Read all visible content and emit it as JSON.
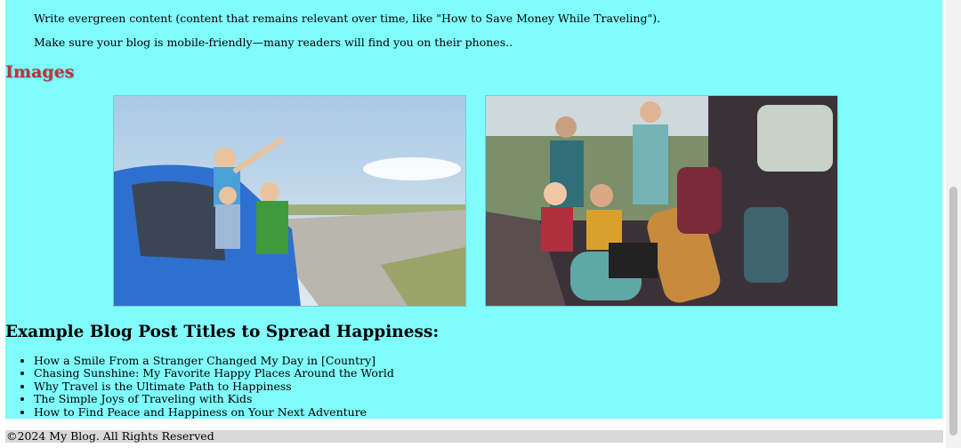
{
  "content": {
    "paragraphs": [
      "Write evergreen content (content that remains relevant over time, like \"How to Save Money While Traveling\").",
      "Make sure your blog is mobile-friendly—many readers will find you on their phones.."
    ],
    "images_heading": "Images",
    "images": [
      {
        "subject": "children waving from a blue car window on a countryside road"
      },
      {
        "subject": "family unpacking luggage from the trunk of a car"
      }
    ],
    "titles_heading": "Example Blog Post Titles to Spread Happiness:",
    "post_titles": [
      "How a Smile From a Stranger Changed My Day in [Country]",
      "Chasing Sunshine: My Favorite Happy Places Around the World",
      "Why Travel is the Ultimate Path to Happiness",
      "The Simple Joys of Traveling with Kids",
      "How to Find Peace and Happiness on Your Next Adventure"
    ]
  },
  "footer": {
    "text": "©2024 My Blog. All Rights Reserved"
  },
  "colors": {
    "page_bg": "#7ffcfb",
    "heading_accent": "#b8333d",
    "footer_bg": "#d9d9d9"
  }
}
